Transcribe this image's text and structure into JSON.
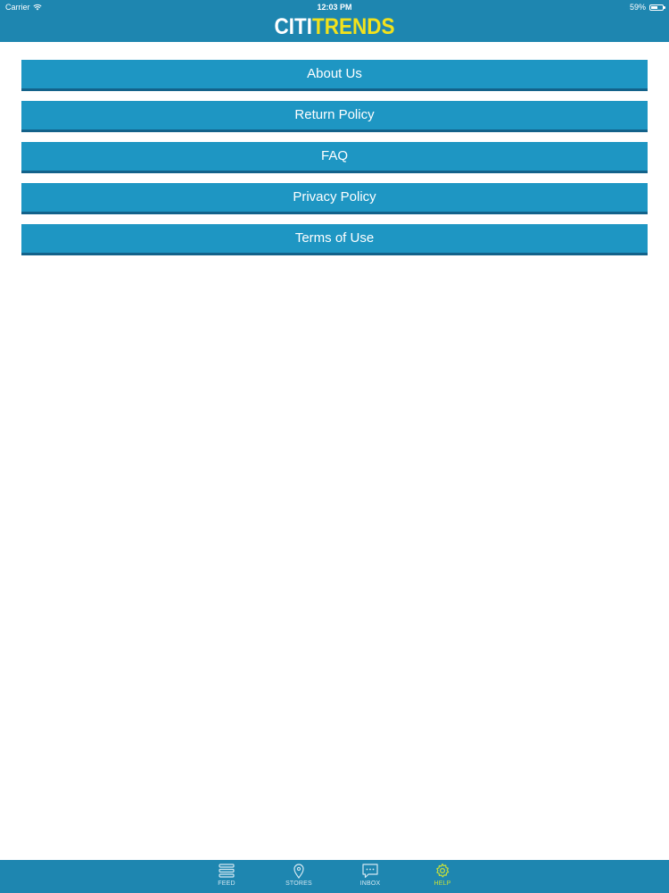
{
  "status_bar": {
    "carrier": "Carrier",
    "time": "12:03 PM",
    "battery_text": "59%",
    "battery_level": 0.59
  },
  "header": {
    "logo_part1": "CITI",
    "logo_part2": "TRENDS"
  },
  "menu": {
    "items": [
      {
        "label": "About Us"
      },
      {
        "label": "Return Policy"
      },
      {
        "label": "FAQ"
      },
      {
        "label": "Privacy Policy"
      },
      {
        "label": "Terms of Use"
      }
    ]
  },
  "tabbar": {
    "tabs": [
      {
        "label": "FEED",
        "icon": "feed-icon"
      },
      {
        "label": "STORES",
        "icon": "location-pin-icon"
      },
      {
        "label": "INBOX",
        "icon": "chat-bubble-icon"
      },
      {
        "label": "HELP",
        "icon": "gear-icon"
      }
    ],
    "active": "HELP"
  },
  "colors": {
    "header_bg": "#1e86b0",
    "button_bg": "#1e96c3",
    "logo_accent": "#f2e21c",
    "active_tab": "#c6e03a"
  }
}
